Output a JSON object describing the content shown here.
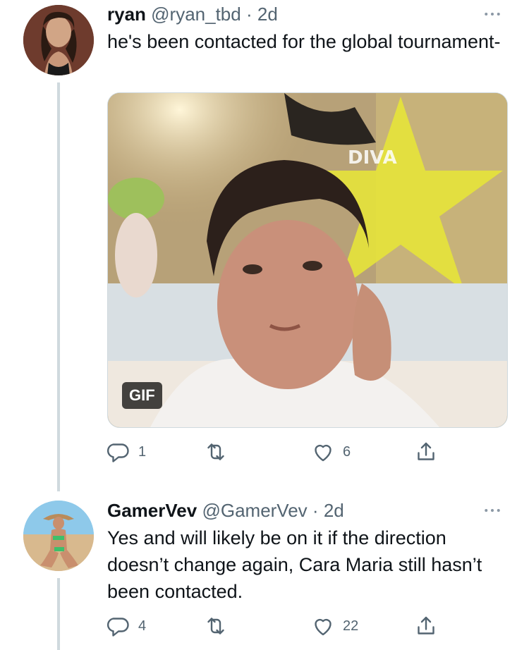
{
  "tweets": [
    {
      "name": "ryan",
      "handle": "@ryan_tbd",
      "separator": "·",
      "time": "2d",
      "text": "he's been contacted for the global tournament-",
      "media": {
        "badge": "GIF",
        "overlay_text": "DIVA"
      },
      "actions": {
        "replies": "1",
        "likes": "6"
      },
      "icons": [
        "reply-icon",
        "retweet-icon",
        "like-icon",
        "share-icon",
        "more-icon"
      ]
    },
    {
      "name": "GamerVev",
      "handle": "@GamerVev",
      "separator": "·",
      "time": "2d",
      "text": "Yes and will likely be on it if the direction doesn’t change again, Cara Maria still hasn’t been contacted.",
      "actions": {
        "replies": "4",
        "likes": "22"
      },
      "icons": [
        "reply-icon",
        "retweet-icon",
        "like-icon",
        "share-icon",
        "more-icon"
      ]
    }
  ],
  "colors": {
    "secondary_text": "#536471",
    "thread_line": "#cfd9de",
    "accent_star": "#e6e33a"
  }
}
